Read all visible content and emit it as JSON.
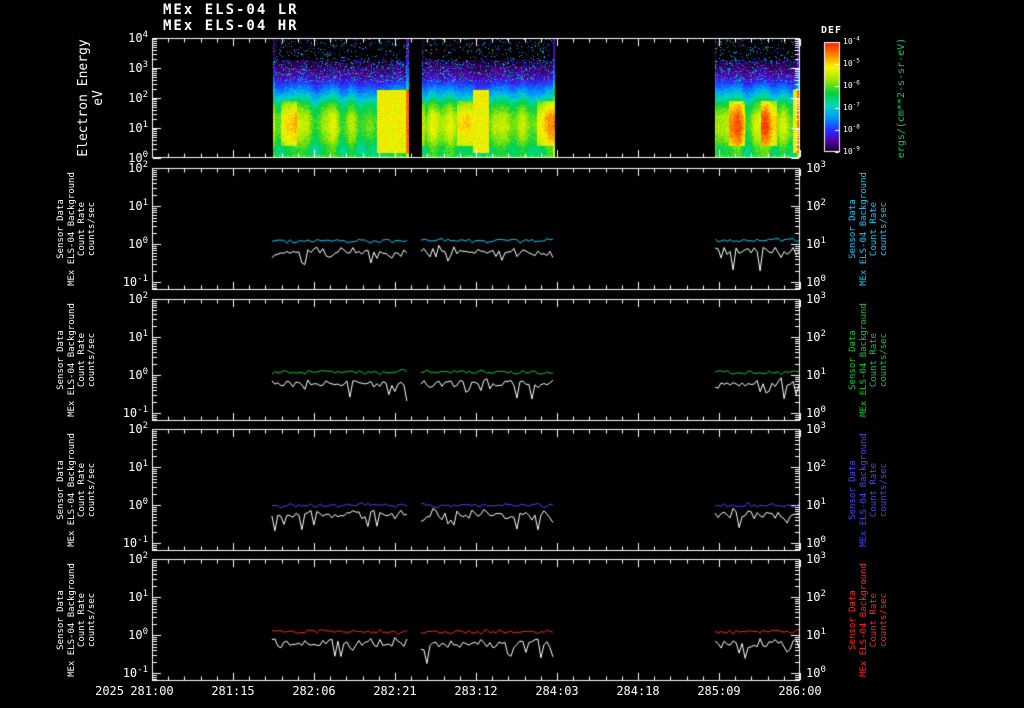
{
  "title": {
    "line1": "MEx ELS-04 LR",
    "line2": "MEx ELS-04 HR"
  },
  "chart_data": {
    "type": "heatmap",
    "subtype": "energy-time-spectrogram-with-count-rate-line-panels",
    "time_axis": {
      "year": "2025",
      "format": "DOY:HH",
      "tick_labels": [
        "281:00",
        "281:15",
        "282:06",
        "282:21",
        "283:12",
        "284:03",
        "284:18",
        "285:09",
        "286:00"
      ]
    },
    "data_segments": [
      {
        "start_frac": 0.185,
        "end_frac": 0.395
      },
      {
        "start_frac": 0.415,
        "end_frac": 0.622
      },
      {
        "start_frac": 0.869,
        "end_frac": 1.0
      }
    ],
    "spectrogram": {
      "ylabel": "Electron Energy",
      "yunits": "eV",
      "y_tick_exponents": [
        4,
        3,
        2,
        1,
        0
      ],
      "energy_range_ev": [
        1,
        10000
      ],
      "colorbar": {
        "title": "DEF",
        "tick_exponents": [
          -4,
          -5,
          -6,
          -7,
          -8,
          -9
        ],
        "units": "ergs/(cm**2-s-sr-eV)",
        "units_color": "#00cc66"
      },
      "intensity_profile": [
        [
          0,
          0.56
        ],
        [
          0.3,
          0.58
        ],
        [
          0.6,
          0.66
        ],
        [
          1.0,
          0.72
        ],
        [
          1.4,
          0.7
        ],
        [
          1.8,
          0.58
        ],
        [
          2.1,
          0.42
        ],
        [
          2.45,
          0.28
        ],
        [
          2.7,
          0.16
        ],
        [
          3.0,
          0.1
        ],
        [
          3.3,
          0.04
        ],
        [
          3.6,
          0.0
        ],
        [
          4.0,
          0.0
        ]
      ],
      "colormap_stops": [
        [
          0,
          "#000000"
        ],
        [
          0.05,
          "#1a0030"
        ],
        [
          0.13,
          "#5a00a0"
        ],
        [
          0.22,
          "#2828ff"
        ],
        [
          0.33,
          "#0090ff"
        ],
        [
          0.44,
          "#00d8c0"
        ],
        [
          0.55,
          "#00d040"
        ],
        [
          0.67,
          "#a0e800"
        ],
        [
          0.78,
          "#f8f800"
        ],
        [
          0.88,
          "#ff9000"
        ],
        [
          1,
          "#ff2000"
        ]
      ]
    },
    "line_panels": [
      {
        "label_lines": [
          "Sensor Data",
          "MEx ELS-04 Background",
          "Count Rate",
          "counts/sec"
        ],
        "accent_color": "#00ccff",
        "left_tick_exponents": [
          2,
          1,
          0,
          -1
        ],
        "right_tick_exponents": [
          3,
          2,
          1,
          0
        ],
        "series": [
          {
            "name": "background-rate",
            "color": "#00ccff",
            "approx_level": 1.25
          },
          {
            "name": "count-rate",
            "color": "#ffffff",
            "approx_level": 0.62
          }
        ]
      },
      {
        "label_lines": [
          "Sensor Data",
          "MEx ELS-04 Background",
          "Count Rate",
          "counts/sec"
        ],
        "accent_color": "#00cc33",
        "left_tick_exponents": [
          2,
          1,
          0,
          -1
        ],
        "right_tick_exponents": [
          3,
          2,
          1,
          0
        ],
        "series": [
          {
            "name": "background-rate",
            "color": "#00cc33",
            "approx_level": 1.2
          },
          {
            "name": "count-rate",
            "color": "#ffffff",
            "approx_level": 0.6
          }
        ]
      },
      {
        "label_lines": [
          "Sensor Data",
          "MEx ELS-04 Background",
          "Count Rate",
          "counts/sec"
        ],
        "accent_color": "#4444ff",
        "left_tick_exponents": [
          2,
          1,
          0,
          -1
        ],
        "right_tick_exponents": [
          3,
          2,
          1,
          0
        ],
        "series": [
          {
            "name": "background-rate",
            "color": "#4444ff",
            "approx_level": 1.0
          },
          {
            "name": "count-rate",
            "color": "#ffffff",
            "approx_level": 0.58
          }
        ]
      },
      {
        "label_lines": [
          "Sensor Data",
          "MEx ELS-04 Background",
          "Count Rate",
          "counts/sec"
        ],
        "accent_color": "#ff2222",
        "left_tick_exponents": [
          2,
          1,
          0,
          -1
        ],
        "right_tick_exponents": [
          3,
          2,
          1,
          0
        ],
        "series": [
          {
            "name": "background-rate",
            "color": "#ff2222",
            "approx_level": 1.25
          },
          {
            "name": "count-rate",
            "color": "#ffffff",
            "approx_level": 0.62
          }
        ]
      }
    ]
  }
}
